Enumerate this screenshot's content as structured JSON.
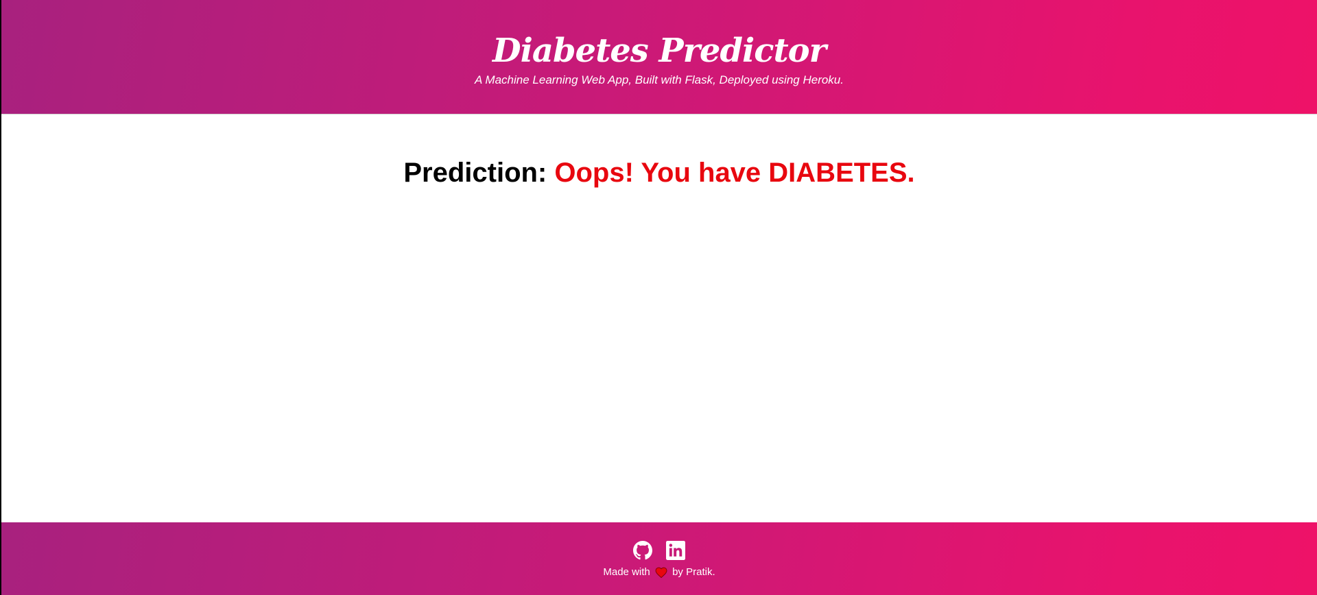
{
  "header": {
    "title": "Diabetes Predictor",
    "subtitle": "A Machine Learning Web App, Built with Flask, Deployed using Heroku."
  },
  "main": {
    "prediction_label": "Prediction:",
    "prediction_result": "Oops! You have DIABETES.",
    "result_color": "#e8070f"
  },
  "footer": {
    "social_icons": [
      "github-icon",
      "linkedin-icon"
    ],
    "credit_prefix": "Made with",
    "heart_icon": "heart-icon",
    "credit_suffix": "by Pratik."
  },
  "colors": {
    "gradient_start": "#a8217e",
    "gradient_end": "#ee1268",
    "text_on_gradient": "#ffffff"
  }
}
